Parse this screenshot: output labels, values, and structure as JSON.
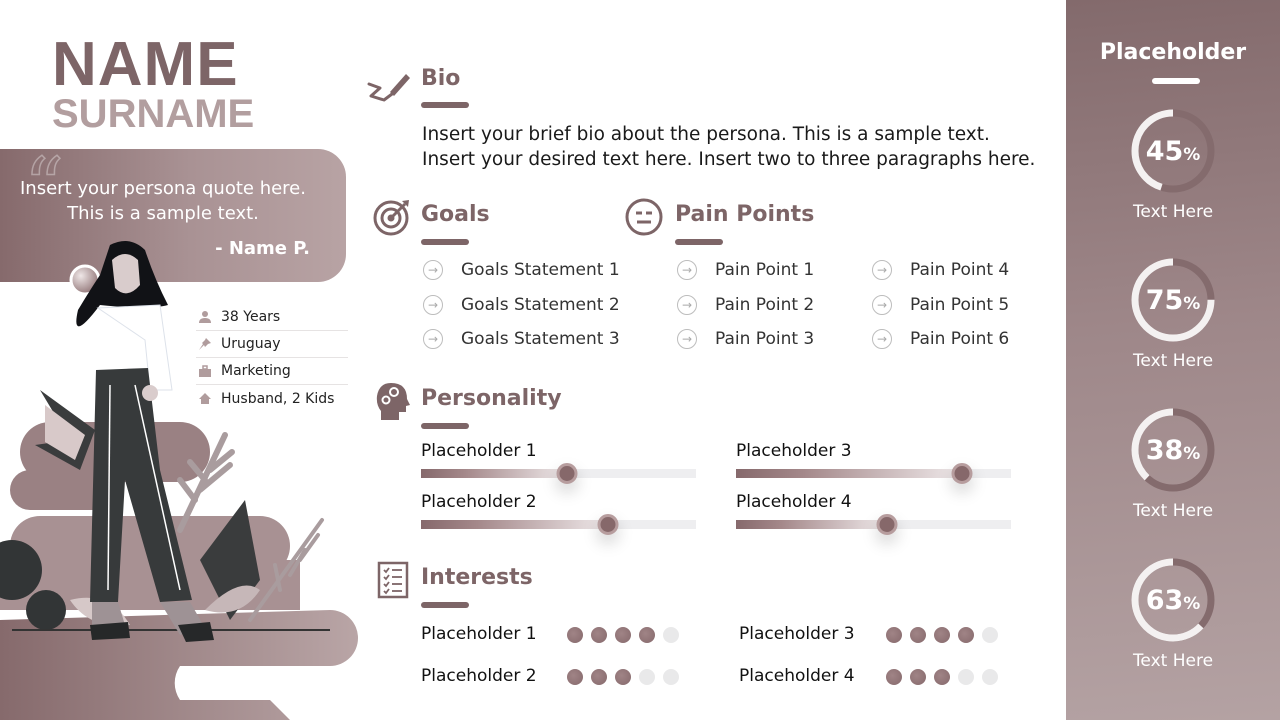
{
  "persona": {
    "name": "NAME",
    "surname": "SURNAME",
    "quote": "Insert your persona quote here. This is a sample text.",
    "quote_author": "- Name P.",
    "facts": [
      {
        "icon": "person-icon",
        "text": "38 Years"
      },
      {
        "icon": "pushpin-icon",
        "text": "Uruguay"
      },
      {
        "icon": "briefcase-icon",
        "text": "Marketing"
      },
      {
        "icon": "house-icon",
        "text": "Husband, 2 Kids"
      }
    ]
  },
  "bio": {
    "title": "Bio",
    "icon": "pen-signature-icon",
    "lines": [
      "Insert your brief bio about the persona. This is a sample text.",
      "Insert your desired text here. Insert two to three paragraphs here."
    ]
  },
  "goals": {
    "title": "Goals",
    "icon": "target-icon",
    "items": [
      "Goals Statement 1",
      "Goals Statement 2",
      "Goals Statement 3"
    ]
  },
  "pain_points": {
    "title": "Pain Points",
    "icon": "neutral-face-icon",
    "items": [
      "Pain Point 1",
      "Pain Point 2",
      "Pain Point 3",
      "Pain Point 4",
      "Pain Point 5",
      "Pain Point 6"
    ]
  },
  "personality": {
    "title": "Personality",
    "icon": "head-gears-icon",
    "traits": [
      {
        "label": "Placeholder 1",
        "value": 0.53
      },
      {
        "label": "Placeholder 2",
        "value": 0.68
      },
      {
        "label": "Placeholder 3",
        "value": 0.82
      },
      {
        "label": "Placeholder 4",
        "value": 0.55
      }
    ]
  },
  "interests": {
    "title": "Interests",
    "icon": "checklist-icon",
    "max": 5,
    "items": [
      {
        "label": "Placeholder 1",
        "rating": 4
      },
      {
        "label": "Placeholder 2",
        "rating": 3
      },
      {
        "label": "Placeholder 3",
        "rating": 4
      },
      {
        "label": "Placeholder 4",
        "rating": 3
      }
    ]
  },
  "stats_panel": {
    "title": "Placeholder",
    "items": [
      {
        "value": "45",
        "unit": "%",
        "percent": 45,
        "label": "Text Here"
      },
      {
        "value": "75",
        "unit": "%",
        "percent": 75,
        "label": "Text Here"
      },
      {
        "value": "38",
        "unit": "%",
        "percent": 38,
        "label": "Text Here"
      },
      {
        "value": "63",
        "unit": "%",
        "percent": 63,
        "label": "Text Here"
      }
    ]
  },
  "colors": {
    "accent": "#7d6567",
    "accent_light": "#b29e9f",
    "track": "#eeeef0",
    "dot_off": "#e9e9ea",
    "panel_top": "#836a6c",
    "panel_bottom": "#b4a2a3"
  }
}
